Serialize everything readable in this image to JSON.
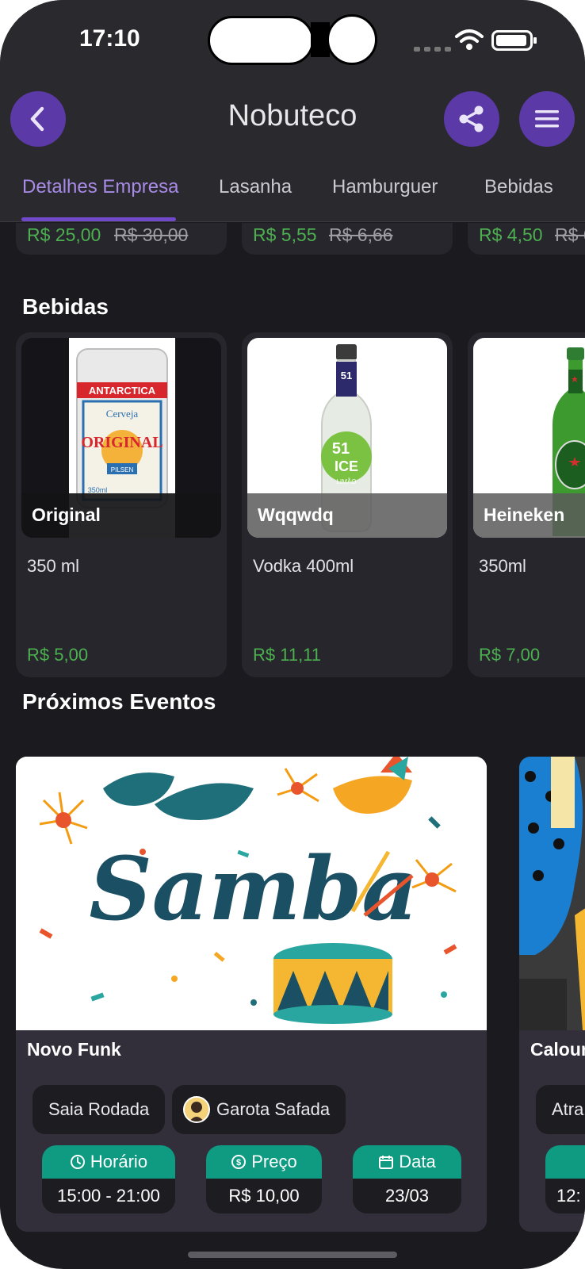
{
  "status_bar": {
    "time": "17:10"
  },
  "header": {
    "title": "Nobuteco"
  },
  "tabs": [
    {
      "label": "Detalhes Empresa",
      "active": true
    },
    {
      "label": "Lasanha",
      "active": false
    },
    {
      "label": "Hamburguer",
      "active": false
    },
    {
      "label": "Bebidas",
      "active": false
    }
  ],
  "previous_row_prices": [
    {
      "price": "R$ 25,00",
      "old_price": "R$ 30,00"
    },
    {
      "price": "R$ 5,55",
      "old_price": "R$ 6,66"
    },
    {
      "price": "R$ 4,50",
      "old_price": "R$ 6"
    }
  ],
  "bebidas": {
    "title": "Bebidas",
    "items": [
      {
        "name": "Original",
        "description": "350 ml",
        "price": "R$ 5,00"
      },
      {
        "name": "Wqqwdq",
        "description": "Vodka 400ml",
        "price": "R$ 11,11"
      },
      {
        "name": "Heineken",
        "description": "350ml",
        "price": "R$ 7,00"
      }
    ]
  },
  "events": {
    "title": "Próximos Eventos",
    "items": [
      {
        "name": "Novo Funk",
        "artists": [
          "Saia Rodada",
          "Garota Safada"
        ],
        "schedule_label": "Horário",
        "schedule_value": "15:00 - 21:00",
        "price_label": "Preço",
        "price_value": "R$ 10,00",
        "date_label": "Data",
        "date_value": "23/03"
      },
      {
        "name": "Calour",
        "artist": "Atra",
        "schedule_value": "12:"
      }
    ]
  },
  "image_text": {
    "can_brand": "ANTARCTICA",
    "can_beer": "Cerveja",
    "can_name": "ORIGINAL",
    "can_type": "PILSEN",
    "can_volume": "350ml",
    "bottle_brand": "51",
    "bottle_ice": "ICE",
    "bottle_flavor": "LIMÃO",
    "event_artwork": "Samba"
  },
  "colors": {
    "accent": "#5b3aa8",
    "price_green": "#4caf50",
    "info_teal": "#0f9a82",
    "background": "#1b1a1f"
  }
}
